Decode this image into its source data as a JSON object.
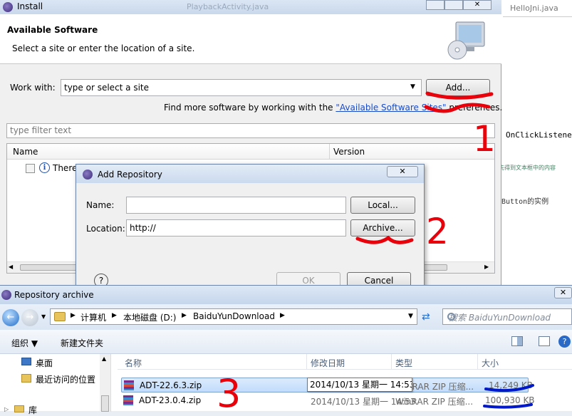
{
  "bg_editor": {
    "tab1": "PlaybackActivity.java",
    "tab2": "HelloJni.java",
    "code1": "OnClickListene",
    "code2": "先得到文本框中的内容",
    "code3": "Button的实例"
  },
  "install": {
    "title": "Install",
    "heading": "Available Software",
    "subheading": "Select a site or enter the location of a site.",
    "work_with_label": "Work with:",
    "work_with_value": "type or select a site",
    "add_button": "Add...",
    "find_more_prefix": "Find more software by working with the ",
    "find_more_link": "\"Available Software Sites\"",
    "find_more_suffix": " preferences.",
    "filter_placeholder": "type filter text",
    "col_name": "Name",
    "col_version": "Version",
    "row_text": "There is no site selected."
  },
  "add_repository": {
    "title": "Add Repository",
    "name_label": "Name:",
    "name_value": "",
    "location_label": "Location:",
    "location_value": "http://",
    "local_button": "Local...",
    "archive_button": "Archive...",
    "ok_button": "OK",
    "cancel_button": "Cancel"
  },
  "archive": {
    "title": "Repository archive",
    "breadcrumb": [
      "计算机",
      "本地磁盘 (D:)",
      "BaiduYunDownload"
    ],
    "search_placeholder": "搜索 BaiduYunDownload",
    "organize": "组织 ▼",
    "new_folder": "新建文件夹",
    "nav_items": [
      "桌面",
      "最近访问的位置",
      "库"
    ],
    "columns": {
      "name": "名称",
      "modified": "修改日期",
      "type": "类型",
      "size": "大小"
    },
    "files": [
      {
        "name": "ADT-22.6.3.zip",
        "modified": "2014/10/13 星期一 14:53",
        "type": "WinRAR ZIP 压缩...",
        "size": "14,249 KB"
      },
      {
        "name": "ADT-23.0.4.zip",
        "modified": "2014/10/13 星期一 14:53",
        "type": "WinRAR ZIP 压缩...",
        "size": "100,930 KB"
      }
    ],
    "tooltip": "2014/10/13 星期一 14:53"
  },
  "annotations": {
    "n1": "1",
    "n2": "2",
    "n3": "3"
  },
  "colors": {
    "annotation": "#e8000b",
    "underline": "#0019c8",
    "link": "#1a4cc8",
    "selection": "#cce8ff"
  }
}
